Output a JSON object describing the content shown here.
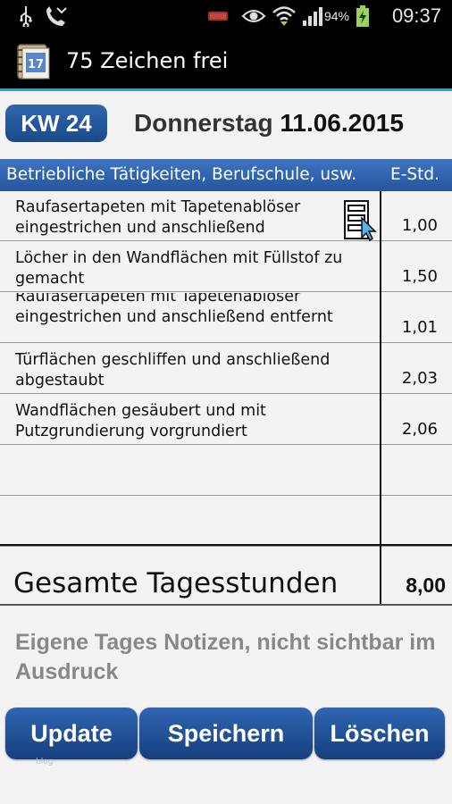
{
  "status_bar": {
    "battery_percent": "94%",
    "time": "09:37",
    "icons": [
      "usb-icon",
      "missed-call-icon",
      "battery-low-indicator-icon",
      "eye-icon",
      "wifi-icon",
      "signal-icon",
      "battery-icon"
    ]
  },
  "app_bar": {
    "title": "75 Zeichen frei",
    "icon": "calendar-book-icon"
  },
  "header": {
    "week_badge": "KW 24",
    "weekday": "Donnerstag",
    "date": "11.06.2015"
  },
  "table": {
    "col_activities": "Betriebliche Tätigkeiten, Berufschule, usw.",
    "col_hours": "E-Std.",
    "rows": [
      {
        "text": "Raufasertapeten mit Tapetenablöser eingestrichen und anschließend",
        "hours": "1,00"
      },
      {
        "text": "Löcher in den Wandflächen mit Füllstof zu gemacht",
        "hours": "1,50"
      },
      {
        "text": "Raufasertapeten mit Tapetenablöser eingestrichen und anschließend entfernt",
        "hours": "1,01"
      },
      {
        "text": "Türflächen geschliffen und anschließend abgestaubt",
        "hours": "2,03"
      },
      {
        "text": "Wandflächen gesäubert und mit Putzgrundierung vorgrundiert",
        "hours": "2,06"
      },
      {
        "text": "",
        "hours": ""
      },
      {
        "text": "",
        "hours": ""
      }
    ]
  },
  "total": {
    "label": "Gesamte Tagesstunden",
    "value": "8,00"
  },
  "notes_placeholder": "Eigene Tages Notizen, nicht sichtbar im  Ausdruck",
  "buttons": {
    "update": "Update",
    "save": "Speichern",
    "delete": "Löschen"
  },
  "watermark": "blog",
  "colors": {
    "accent_blue": "#2f67ad",
    "header_blue": "#3e74c2",
    "appbar_line": "#2f9fd8"
  }
}
